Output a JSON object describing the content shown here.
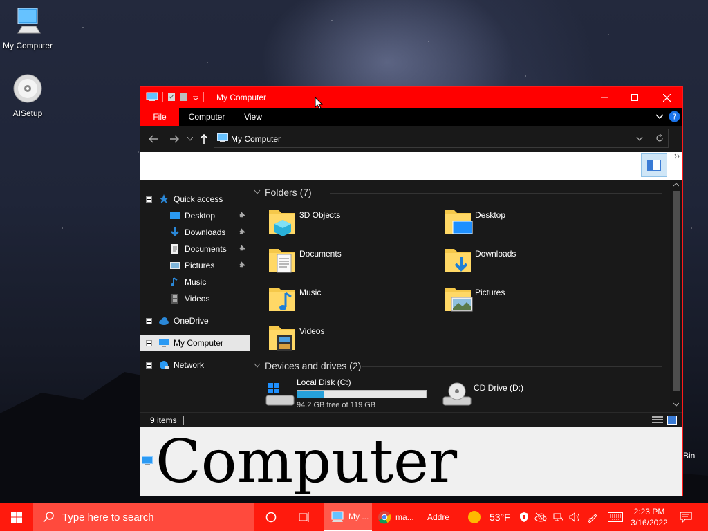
{
  "desktop": {
    "icons": [
      {
        "label": "My Computer",
        "icon": "monitor-icon"
      },
      {
        "label": "AISetup",
        "icon": "cd-disc-icon"
      }
    ],
    "partial_icon_label": "Bin"
  },
  "window": {
    "title": "My Computer",
    "ribbon_tabs": [
      "File",
      "Computer",
      "View"
    ],
    "address": "My Computer",
    "nav": {
      "quick_access": "Quick access",
      "quick_items": [
        {
          "label": "Desktop",
          "pinned": true
        },
        {
          "label": "Downloads",
          "pinned": true
        },
        {
          "label": "Documents",
          "pinned": true
        },
        {
          "label": "Pictures",
          "pinned": true
        },
        {
          "label": "Music",
          "pinned": false
        },
        {
          "label": "Videos",
          "pinned": false
        }
      ],
      "onedrive": "OneDrive",
      "this_pc": "My Computer",
      "network": "Network"
    },
    "folders_header": "Folders (7)",
    "folders": [
      "3D Objects",
      "Desktop",
      "Documents",
      "Downloads",
      "Music",
      "Pictures",
      "Videos"
    ],
    "devices_header": "Devices and drives (2)",
    "drives": [
      {
        "name": "Local Disk (C:)",
        "free_text": "94.2 GB free of 119 GB",
        "used_fraction": 0.21
      },
      {
        "name": "CD Drive (D:)"
      }
    ],
    "status": "9 items",
    "preview_text": "Computer"
  },
  "taskbar": {
    "search_placeholder": "Type here to search",
    "apps": [
      {
        "label": "My ...",
        "icon": "explorer-icon"
      },
      {
        "label": "ma...",
        "icon": "chrome-icon"
      }
    ],
    "address_label": "Addre",
    "weather": "53°F",
    "time": "2:23 PM",
    "date": "3/16/2022"
  },
  "colors": {
    "accent": "#ff0000",
    "taskbar": "#ff1a0d",
    "folder": "#f5c84a",
    "progress": "#26a0da"
  }
}
